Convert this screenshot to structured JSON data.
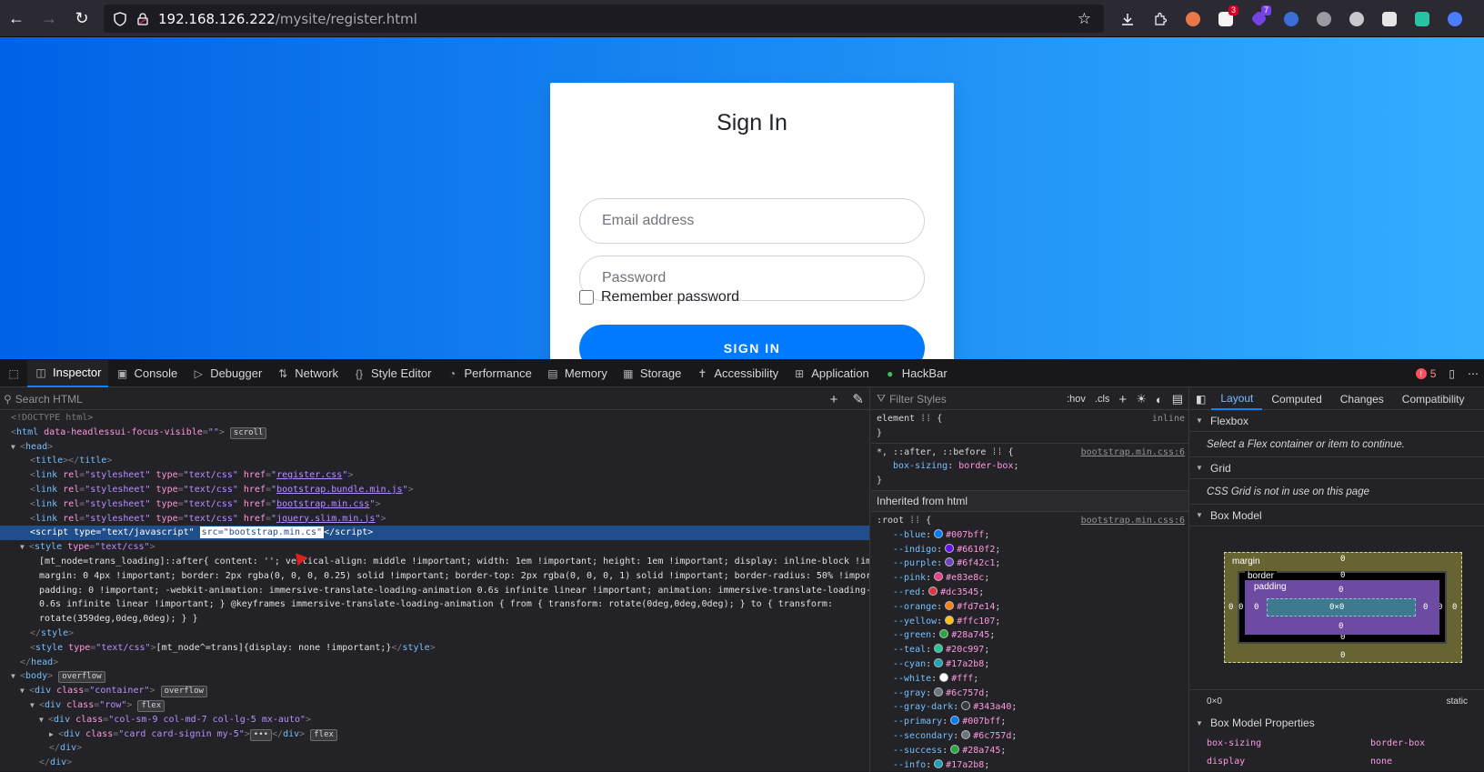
{
  "browser": {
    "url_host": "192.168.126.222",
    "url_path": "/mysite/register.html",
    "icons": [
      "back-icon",
      "forward-icon",
      "reload-icon",
      "shield-icon",
      "lock-icon",
      "star-icon",
      "download-icon",
      "extensions-icon"
    ],
    "ext_badge_red": "3",
    "ext_badge_purple": "7"
  },
  "page": {
    "title": "Sign In",
    "email_placeholder": "Email address",
    "password_placeholder": "Password",
    "remember_label": "Remember password",
    "signin_label": "SIGN IN",
    "gradient_start": "#0062e6",
    "gradient_end": "#33aeff"
  },
  "devtools": {
    "tabs": [
      {
        "label": "Inspector",
        "icon": "inspector-icon"
      },
      {
        "label": "Console",
        "icon": "console-icon"
      },
      {
        "label": "Debugger",
        "icon": "debugger-icon"
      },
      {
        "label": "Network",
        "icon": "network-icon"
      },
      {
        "label": "Style Editor",
        "icon": "braces-icon"
      },
      {
        "label": "Performance",
        "icon": "gauge-icon"
      },
      {
        "label": "Memory",
        "icon": "chip-icon"
      },
      {
        "label": "Storage",
        "icon": "storage-icon"
      },
      {
        "label": "Accessibility",
        "icon": "accessibility-icon"
      },
      {
        "label": "Application",
        "icon": "grid-icon"
      },
      {
        "label": "HackBar",
        "icon": "hackbar-icon"
      }
    ],
    "error_count": "5",
    "search_placeholder": "Search HTML",
    "filter_placeholder": "Filter Styles",
    "hov": ":hov",
    "cls": ".cls",
    "html_lines": {
      "doctype": "<!DOCTYPE html>",
      "style_rule": "[mt_node=trans_loading]::after{ content: ''; vertical-align: middle !important; width: 1em !important; height: 1em !important; display: inline-block !important;",
      "style_rule2": "margin: 0 4px !important; border: 2px rgba(0, 0, 0, 0.25) solid !important; border-top: 2px rgba(0, 0, 0, 1) solid !important; border-radius: 50% !important;",
      "style_rule3": "padding: 0 !important; -webkit-animation: immersive-translate-loading-animation 0.6s infinite linear !important; animation: immersive-translate-loading-animation",
      "style_rule4": "0.6s infinite linear !important; } @keyframes immersive-translate-loading-animation { from { transform: rotate(0deg,0deg,0deg); } to { transform:",
      "style_rule5": "rotate(359deg,0deg,0deg); } }",
      "style2": "[mt_node^=trans]{display: none !important;}",
      "href_register": "register.css",
      "href_bundle": "bootstrap.bundle.min.js",
      "href_bootstrap": "bootstrap.min.css",
      "href_jquery": "jquery.slim.min.js",
      "script_src": "src=\"bootstrap.min.cs\"",
      "html_attr": "data-headlessui-focus-visible",
      "container_class": "container",
      "row_class": "row",
      "col_class": "col-sm-9 col-md-7 col-lg-5 mx-auto",
      "card_class": "card card-signin my-5",
      "badge_scroll": "scroll",
      "badge_overflow": "overflow",
      "badge_flex": "flex",
      "badge_ellipsis": "•••"
    },
    "rules": {
      "element_label": "element",
      "element_src": "inline",
      "universal_selector": "*, ::after, ::before",
      "universal_src": "bootstrap.min.css:6",
      "box_sizing_prop": "box-sizing",
      "box_sizing_val": "border-box",
      "inherited_from": "Inherited from html",
      "root_selector": ":root",
      "root_src": "bootstrap.min.css:6",
      "vars": [
        {
          "name": "--blue",
          "value": "#007bff"
        },
        {
          "name": "--indigo",
          "value": "#6610f2"
        },
        {
          "name": "--purple",
          "value": "#6f42c1"
        },
        {
          "name": "--pink",
          "value": "#e83e8c"
        },
        {
          "name": "--red",
          "value": "#dc3545"
        },
        {
          "name": "--orange",
          "value": "#fd7e14"
        },
        {
          "name": "--yellow",
          "value": "#ffc107"
        },
        {
          "name": "--green",
          "value": "#28a745"
        },
        {
          "name": "--teal",
          "value": "#20c997"
        },
        {
          "name": "--cyan",
          "value": "#17a2b8"
        },
        {
          "name": "--white",
          "value": "#fff"
        },
        {
          "name": "--gray",
          "value": "#6c757d"
        },
        {
          "name": "--gray-dark",
          "value": "#343a40"
        },
        {
          "name": "--primary",
          "value": "#007bff"
        },
        {
          "name": "--secondary",
          "value": "#6c757d"
        },
        {
          "name": "--success",
          "value": "#28a745"
        },
        {
          "name": "--info",
          "value": "#17a2b8"
        }
      ]
    },
    "layout": {
      "tabs": [
        "Layout",
        "Computed",
        "Changes",
        "Compatibility"
      ],
      "flexbox": "Flexbox",
      "flexbox_note": "Select a Flex container or item to continue.",
      "grid": "Grid",
      "grid_note": "CSS Grid is not in use on this page",
      "boxmodel": "Box Model",
      "margin_label": "margin",
      "border_label": "border",
      "padding_label": "padding",
      "content_size": "0×0",
      "zero": "0",
      "element_size": "0×0",
      "position": "static",
      "props_header": "Box Model Properties",
      "props": [
        {
          "k": "box-sizing",
          "v": "border-box"
        },
        {
          "k": "display",
          "v": "none"
        }
      ]
    }
  }
}
